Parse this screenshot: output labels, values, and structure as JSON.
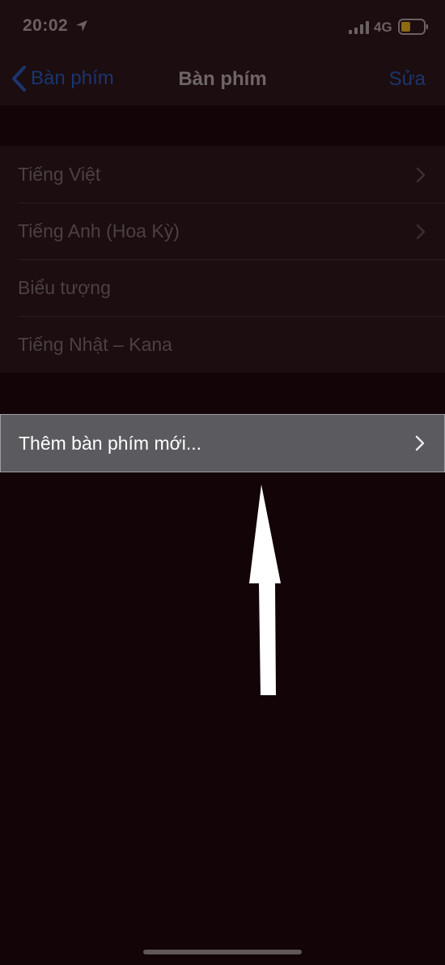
{
  "status_bar": {
    "time": "20:02",
    "network": "4G",
    "icons": [
      "location-arrow-icon",
      "cellular-signal-icon",
      "battery-icon"
    ]
  },
  "nav": {
    "back_label": "Bàn phím",
    "title": "Bàn phím",
    "edit_label": "Sửa",
    "accent_color": "#1b356f"
  },
  "keyboards": {
    "items": [
      {
        "label": "Tiếng Việt",
        "has_chevron": true
      },
      {
        "label": "Tiếng Anh (Hoa Kỳ)",
        "has_chevron": true
      },
      {
        "label": "Biểu tượng",
        "has_chevron": false
      },
      {
        "label": "Tiếng Nhật – Kana",
        "has_chevron": false
      }
    ]
  },
  "add_keyboard": {
    "label": "Thêm bàn phím mới...",
    "highlight_color": "#5b5a5f"
  },
  "overlay": {
    "icon": "up-arrow-annotation-icon",
    "color": "#ffffff"
  }
}
